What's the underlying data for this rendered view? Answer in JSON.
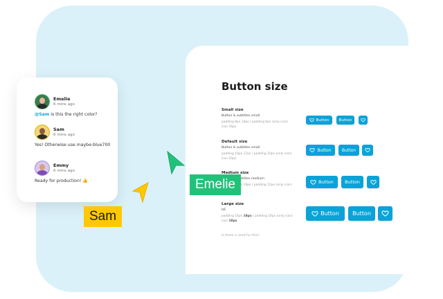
{
  "panel": {
    "title": "Button size",
    "rows": [
      {
        "label": "Small size",
        "sub": "Button & subtitles small",
        "spec1": "padding 6px 10px / padding 6px (only icon)",
        "spec2": "icon 16px",
        "btn_label": "Button",
        "btn_label2": "Button"
      },
      {
        "label": "Default size",
        "sub": "Button & subtitles small",
        "spec1": "padding 10px 17px / padding 10px (only icon)",
        "spec2": "icon 20px",
        "btn_label": "Button",
        "btn_label2": "Button"
      },
      {
        "label": "Medium size",
        "sub": "Button & subtitles medium",
        "spec1": "padding 12px 19px / padding 12px (only icon)",
        "spec2": "icon 22px",
        "btn_label": "Button",
        "btn_label2": "Button"
      },
      {
        "label": "Large size",
        "sub": "h6",
        "spec1_pre": "padding 16px ",
        "spec1_bold": "18px",
        "spec1_post": " / padding 16px (only icon)",
        "spec2_pre": "icon ",
        "spec2_bold": "18px",
        "btn_label": "Button",
        "btn_label2": "Button"
      }
    ],
    "question": "Is there a need for this?"
  },
  "chat": {
    "messages": [
      {
        "name": "Emelie",
        "time": "6 mins ago",
        "mention": "@Sam",
        "text": " is this the right color?"
      },
      {
        "name": "Sam",
        "time": "6 mins ago",
        "text": "Yes! Otherwise use maybe-blue700"
      },
      {
        "name": "Emmy",
        "time": "6 mins ago",
        "text": "Ready for production! 👍"
      }
    ]
  },
  "cursors": {
    "sam": {
      "label": "Sam",
      "color": "#ffc800"
    },
    "emelie": {
      "label": "Emelie",
      "color": "#20c27a"
    }
  },
  "colors": {
    "accent": "#0aa3d8",
    "background": "#dbf1f9"
  }
}
